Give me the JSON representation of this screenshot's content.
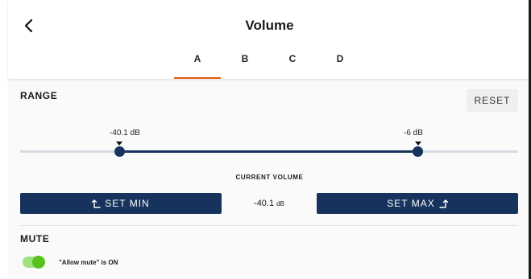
{
  "header": {
    "title": "Volume",
    "back_icon": "chevron-left-icon"
  },
  "tabs": [
    {
      "label": "A",
      "active": true
    },
    {
      "label": "B",
      "active": false
    },
    {
      "label": "C",
      "active": false
    },
    {
      "label": "D",
      "active": false
    }
  ],
  "range": {
    "label": "RANGE",
    "reset_label": "RESET",
    "min_label": "-40.1 dB",
    "max_label": "-6 dB",
    "min_value_db": -40.1,
    "max_value_db": -6
  },
  "current_volume": {
    "label": "CURRENT VOLUME",
    "value": "-40.1",
    "unit": "dB"
  },
  "buttons": {
    "set_min": "SET MIN",
    "set_max": "SET MAX"
  },
  "mute": {
    "label": "MUTE",
    "toggle_on": true,
    "status_text": "\"Allow mute\" is ON"
  },
  "colors": {
    "primary": "#15335d",
    "tab_accent": "#e8590c",
    "toggle_on": "#56c21c"
  }
}
